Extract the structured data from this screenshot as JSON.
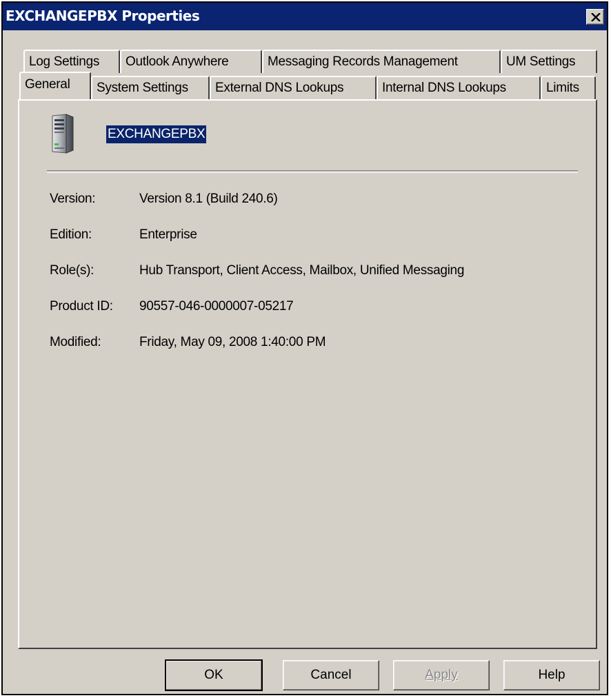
{
  "window": {
    "title": "EXCHANGEPBX Properties"
  },
  "tabs": {
    "row_back": [
      {
        "label": "Log Settings"
      },
      {
        "label": "Outlook Anywhere"
      },
      {
        "label": "Messaging Records Management"
      },
      {
        "label": "UM Settings"
      }
    ],
    "row_front": [
      {
        "label": "General"
      },
      {
        "label": "System Settings"
      },
      {
        "label": "External DNS Lookups"
      },
      {
        "label": "Internal DNS Lookups"
      },
      {
        "label": "Limits"
      }
    ],
    "active": "General"
  },
  "general": {
    "server_icon": "server-tower-icon",
    "server_name": "EXCHANGEPBX",
    "properties": [
      {
        "label": "Version:",
        "value": "Version 8.1 (Build 240.6)"
      },
      {
        "label": "Edition:",
        "value": "Enterprise"
      },
      {
        "label": "Role(s):",
        "value": "Hub Transport, Client Access, Mailbox, Unified Messaging"
      },
      {
        "label": "Product ID:",
        "value": "90557-046-0000007-05217"
      },
      {
        "label": "Modified:",
        "value": "Friday, May 09, 2008 1:40:00 PM"
      }
    ]
  },
  "buttons": {
    "ok": "OK",
    "cancel": "Cancel",
    "apply": "Apply",
    "help": "Help"
  },
  "colors": {
    "titlebar": "#0a2472",
    "face": "#d4d0c8",
    "selection": "#0a246a"
  }
}
